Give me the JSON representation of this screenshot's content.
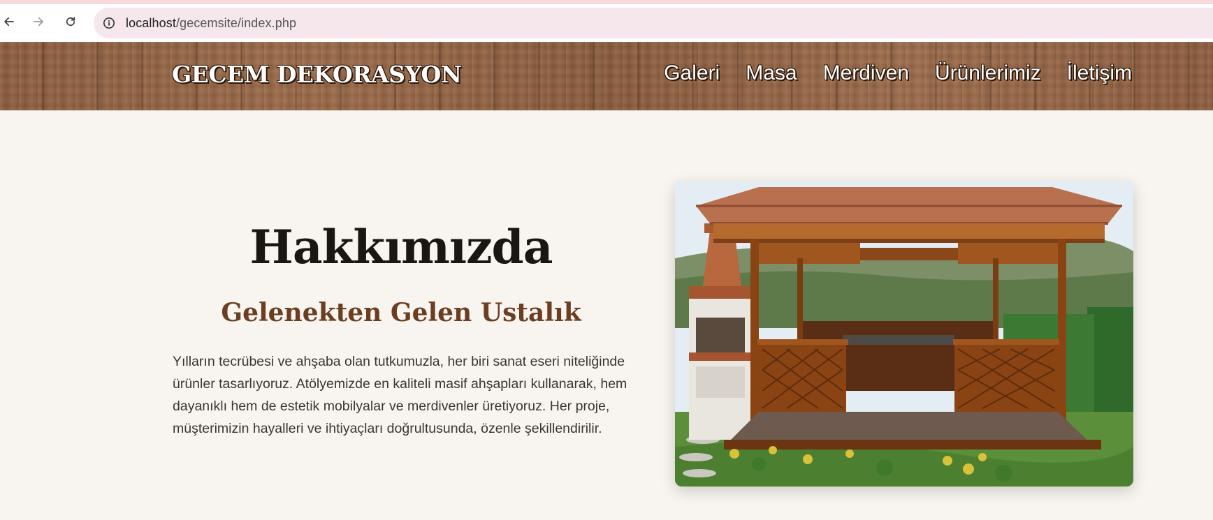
{
  "browser": {
    "url_host": "localhost",
    "url_path": "/gecemsite/index.php"
  },
  "header": {
    "logo": "GECEM DEKORASYON",
    "nav": [
      "Galeri",
      "Masa",
      "Merdiven",
      "Ürünlerimiz",
      "İletişim"
    ]
  },
  "about": {
    "title": "Hakkımızda",
    "subtitle": "Gelenekten Gelen Ustalık",
    "text": "Yılların tecrübesi ve ahşaba olan tutkumuzla, her biri sanat eseri niteliğinde ürünler tasarlıyoruz. Atölyemizde en kaliteli masif ahşapları kullanarak, hem dayanıklı hem de estetik mobilyalar ve merdivenler üretiyoruz. Her proje, müşterimizin hayalleri ve ihtiyaçları doğrultusunda, özenle şekillendirilir."
  },
  "colors": {
    "page_bg": "#f8f5f0",
    "header_wood": "#8b5d3f",
    "subtitle": "#6b3e22",
    "title": "#1a1612"
  }
}
